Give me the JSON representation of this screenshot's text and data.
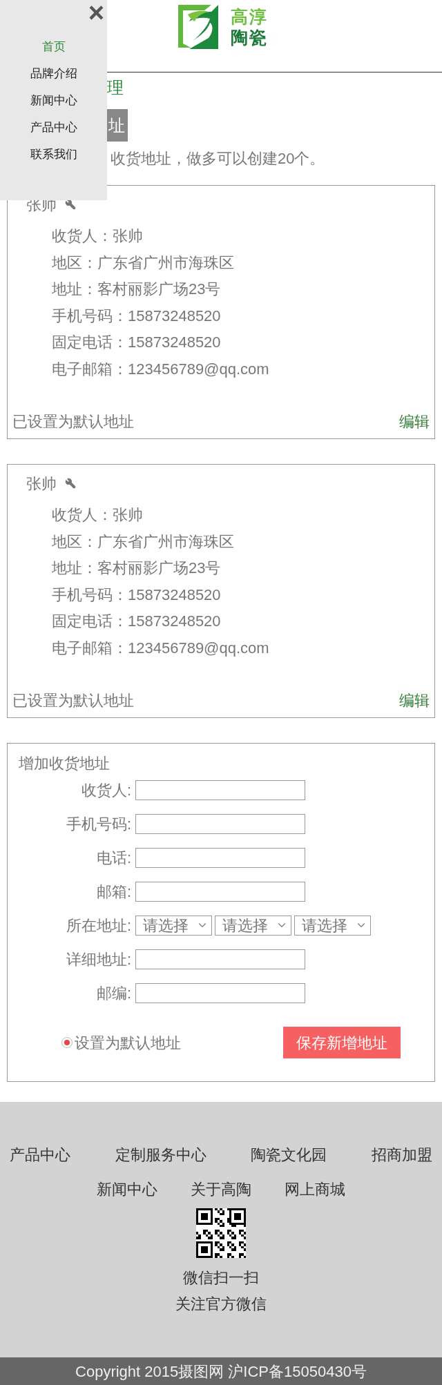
{
  "logo": {
    "lines": [
      "高淳",
      "陶瓷"
    ]
  },
  "menu": {
    "close": "×",
    "items": [
      {
        "label": "首页",
        "selected": true
      },
      {
        "label": "品牌介绍",
        "selected": false
      },
      {
        "label": "新闻中心",
        "selected": false
      },
      {
        "label": "产品中心",
        "selected": false
      },
      {
        "label": "联系我们",
        "selected": false
      }
    ]
  },
  "page_title": "理",
  "add_button": "址",
  "note": "收货地址，做多可以创建20个。",
  "addresses": [
    {
      "name": "张帅",
      "fields": [
        {
          "label": "收货人：",
          "value": "张帅"
        },
        {
          "label": "地区：",
          "value": "广东省广州市海珠区"
        },
        {
          "label": "地址：",
          "value": "客村丽影广场23号"
        },
        {
          "label": "手机号码：",
          "value": "15873248520"
        },
        {
          "label": "固定电话：",
          "value": "15873248520"
        },
        {
          "label": "电子邮箱：",
          "value": "123456789@qq.com"
        }
      ],
      "status": "已设置为默认地址",
      "edit": "编辑"
    },
    {
      "name": "张帅",
      "fields": [
        {
          "label": "收货人：",
          "value": "张帅"
        },
        {
          "label": "地区：",
          "value": "广东省广州市海珠区"
        },
        {
          "label": "地址：",
          "value": "客村丽影广场23号"
        },
        {
          "label": "手机号码：",
          "value": "15873248520"
        },
        {
          "label": "固定电话：",
          "value": "15873248520"
        },
        {
          "label": "电子邮箱：",
          "value": "123456789@qq.com"
        }
      ],
      "status": "已设置为默认地址",
      "edit": "编辑"
    }
  ],
  "form": {
    "title": "增加收货地址",
    "fields": [
      {
        "kind": "input",
        "label": "收货人:"
      },
      {
        "kind": "input",
        "label": "手机号码:"
      },
      {
        "kind": "input",
        "label": "电话:"
      },
      {
        "kind": "input",
        "label": "邮箱:"
      },
      {
        "kind": "select",
        "label": "所在地址:",
        "options": [
          "请选择",
          "请选择",
          "请选择"
        ]
      },
      {
        "kind": "input",
        "label": "详细地址:"
      },
      {
        "kind": "input",
        "label": "邮编:"
      }
    ],
    "default_option": {
      "label": "设置为默认地址",
      "checked": true
    },
    "save": "保存新增地址"
  },
  "footer": {
    "links_row_1": [
      "产品中心",
      "定制服务中心",
      "陶瓷文化园",
      "招商加盟"
    ],
    "links_row_2": [
      "新闻中心",
      "关于高陶",
      "网上商城"
    ],
    "qr_caption": [
      "微信扫一扫",
      "关注官方微信"
    ],
    "copyright": "Copyright 2015摄图网 沪ICP备15050430号"
  }
}
